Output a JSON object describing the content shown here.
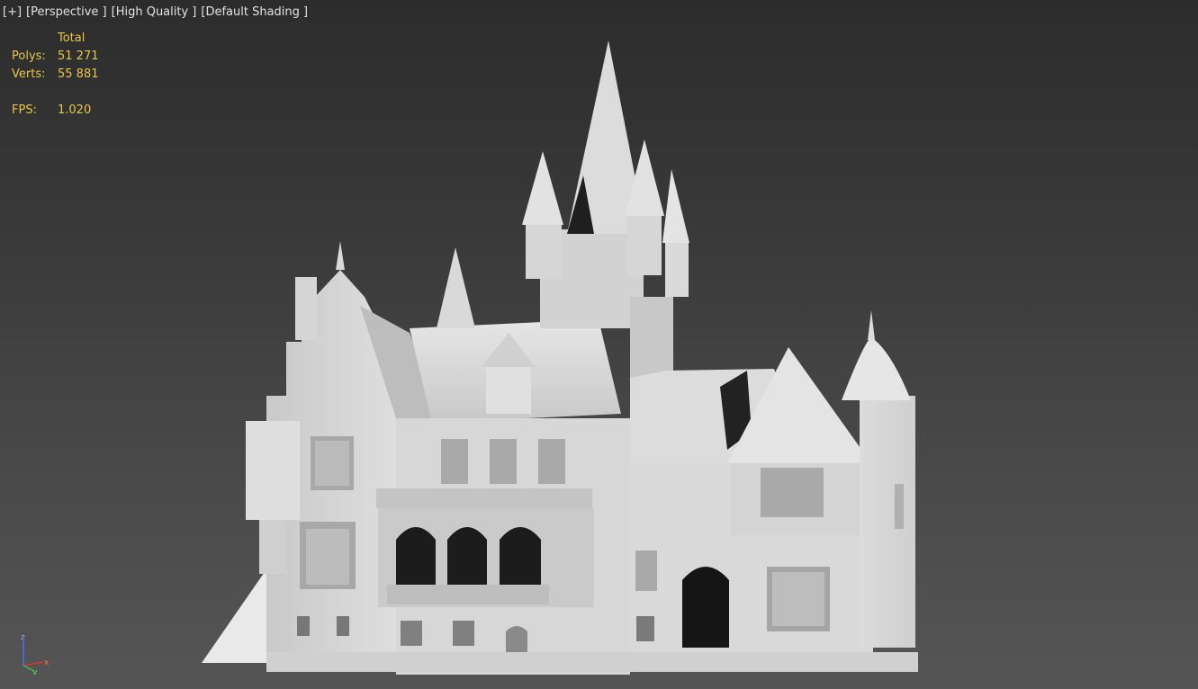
{
  "viewport": {
    "labels": {
      "plus": "[+]",
      "view": "[Perspective ]",
      "quality": "[High Quality ]",
      "shading": "[Default Shading ]"
    },
    "stats": {
      "header": "Total",
      "polys_label": "Polys:",
      "polys_value": "51 271",
      "verts_label": "Verts:",
      "verts_value": "55 881",
      "fps_label": "FPS:",
      "fps_value": "1.020"
    },
    "axis_gizmo": {
      "x": "x",
      "y": "y",
      "z": "z"
    },
    "colors": {
      "background_top": "#2c2c2c",
      "background_bottom": "#555555",
      "stats_text": "#e8c44a",
      "label_text": "#e2e2e2",
      "model": "#d8d8d8"
    },
    "model_icon": "castle-model"
  }
}
